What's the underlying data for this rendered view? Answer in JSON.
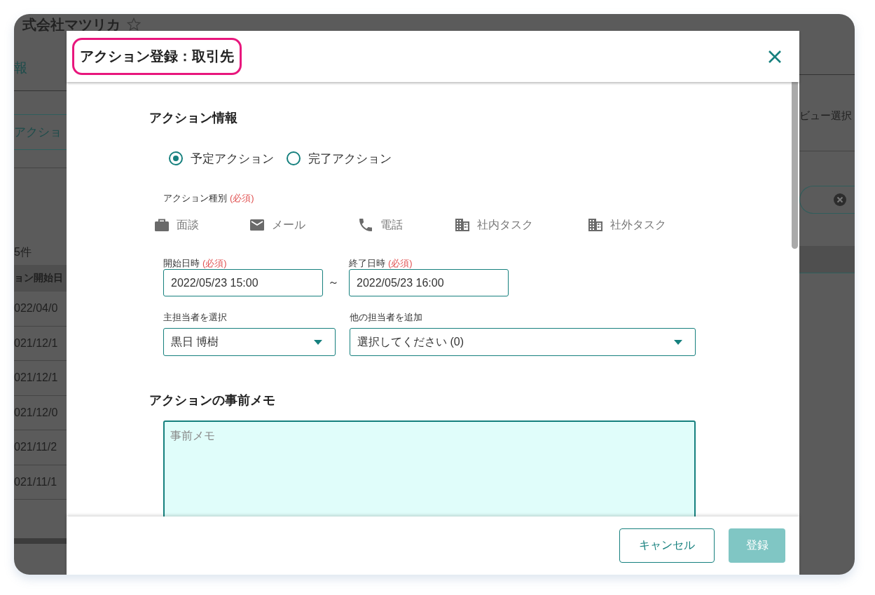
{
  "app": {
    "company": "式会社マツリカ",
    "tab": "報",
    "subtab": "アクショ",
    "view_select": "ビュー選択",
    "count": "5件",
    "column_header": "ョン開始日",
    "rows": [
      "022/04/0",
      "021/12/1",
      "021/12/1",
      "021/12/0",
      "021/11/2",
      "021/11/1"
    ]
  },
  "dialog": {
    "title": "アクション登録：取引先",
    "section_title": "アクション情報",
    "status_options": [
      {
        "label": "予定アクション",
        "selected": true
      },
      {
        "label": "完了アクション",
        "selected": false
      }
    ],
    "type_label": "アクション種別",
    "type_required": "(必須)",
    "types": [
      {
        "kind": "meeting",
        "label": "面談"
      },
      {
        "kind": "mail",
        "label": "メール"
      },
      {
        "kind": "phone",
        "label": "電話"
      },
      {
        "kind": "internal",
        "label": "社内タスク"
      },
      {
        "kind": "external",
        "label": "社外タスク"
      }
    ],
    "start": {
      "label": "開始日時",
      "required": "(必須)",
      "value": "2022/05/23 15:00"
    },
    "range_separator": "～",
    "end": {
      "label": "終了日時",
      "required": "(必須)",
      "value": "2022/05/23 16:00"
    },
    "owner": {
      "label": "主担当者を選択",
      "value": "黒日 博樹"
    },
    "others": {
      "label": "他の担当者を追加",
      "value": "選択してください (0)"
    },
    "memo_title": "アクションの事前メモ",
    "memo": {
      "placeholder": "事前メモ"
    },
    "buttons": [
      {
        "kind": "secondary",
        "label": "キャンセル",
        "disabled": false
      },
      {
        "kind": "primary",
        "label": "登録",
        "disabled": true
      }
    ]
  }
}
